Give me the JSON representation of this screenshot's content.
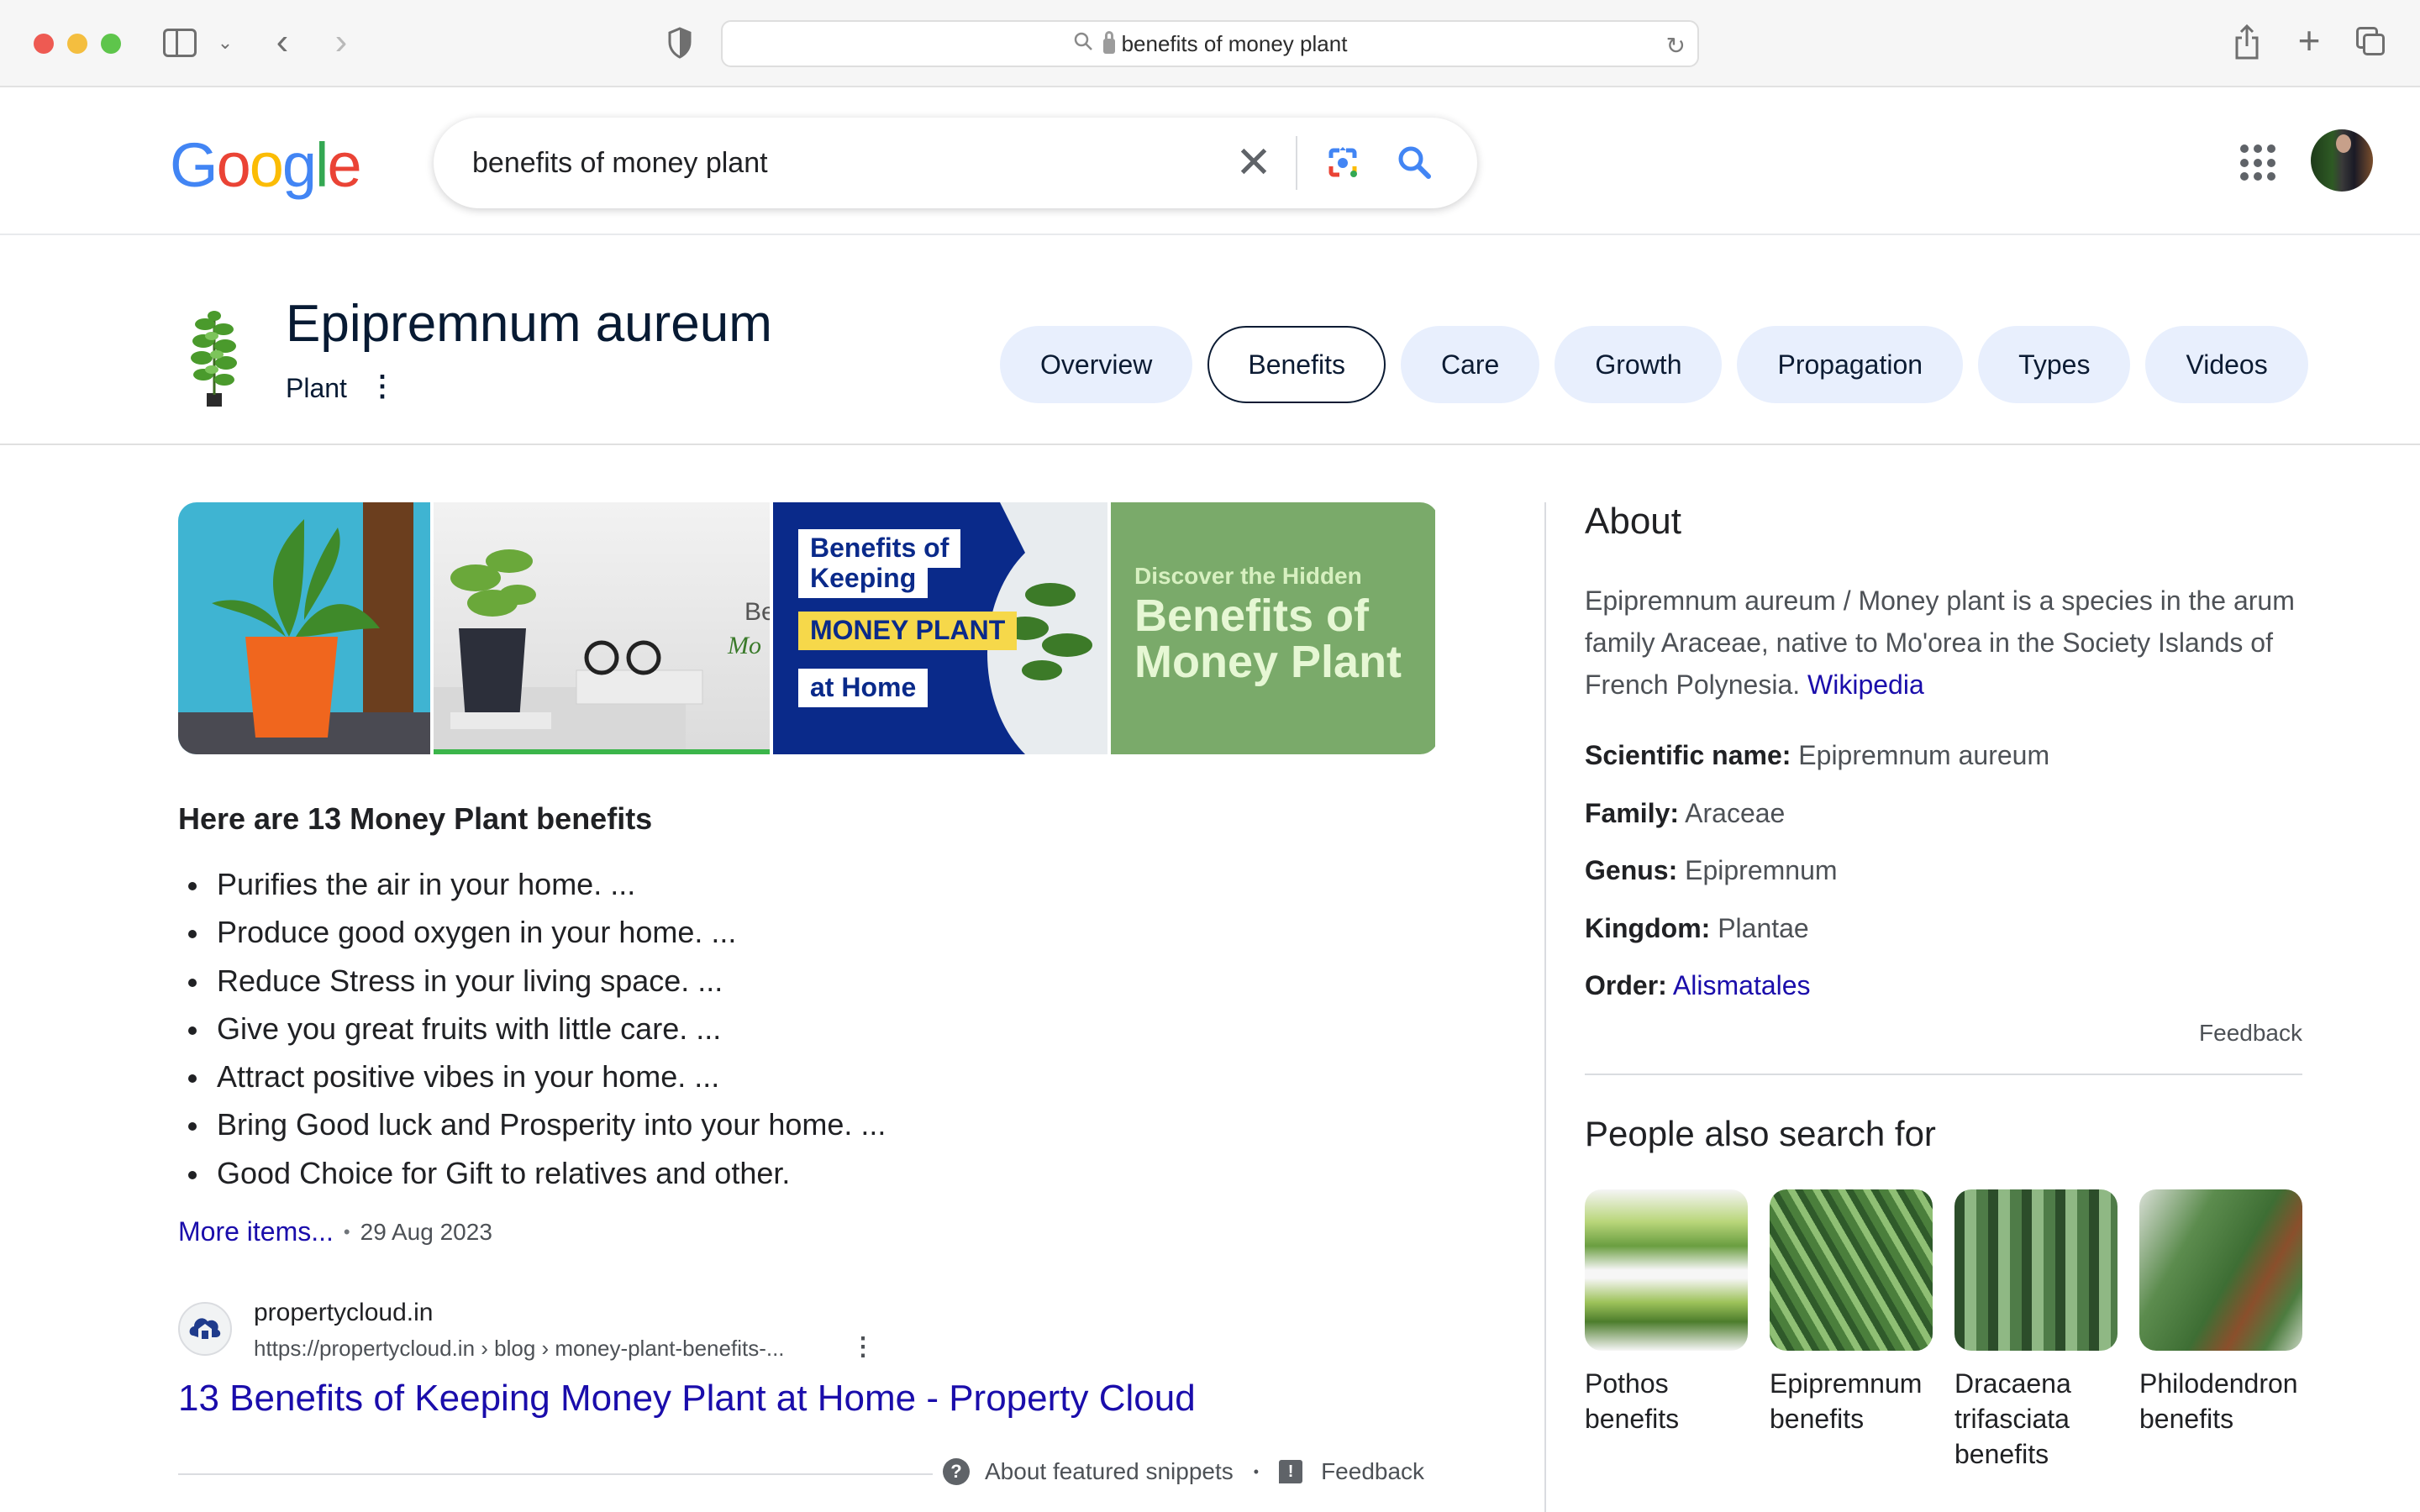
{
  "browser": {
    "url_text": "benefits of money plant",
    "icons": {
      "sidebar": "sidebar-icon",
      "sidebar_chevron": "chevron-down-icon",
      "back": "chevron-left-icon",
      "forward": "chevron-right-icon",
      "privacy": "shield-icon",
      "search": "magnifier-icon",
      "lock": "lock-icon",
      "reload": "reload-icon",
      "share": "share-icon",
      "new_tab": "plus-icon",
      "tabs": "tab-overview-icon"
    }
  },
  "google": {
    "logo_letters": [
      "G",
      "o",
      "o",
      "g",
      "l",
      "e"
    ],
    "search_query": "benefits of money plant",
    "icons": {
      "clear": "close-icon",
      "lens": "google-lens-icon",
      "search": "search-icon",
      "apps": "apps-grid-icon",
      "avatar": "user-avatar"
    }
  },
  "entity": {
    "title": "Epipremnum aureum",
    "subtitle": "Plant",
    "chips": [
      {
        "label": "Overview",
        "active": false
      },
      {
        "label": "Benefits",
        "active": true
      },
      {
        "label": "Care",
        "active": false
      },
      {
        "label": "Growth",
        "active": false
      },
      {
        "label": "Propagation",
        "active": false
      },
      {
        "label": "Types",
        "active": false
      },
      {
        "label": "Videos",
        "active": false
      }
    ]
  },
  "images": [
    {
      "alt": "Money plant in orange pot"
    },
    {
      "alt": "Money plant on table with glasses",
      "overlay_text": "Be Mo"
    },
    {
      "alt": "Benefits of Keeping Money Plant at Home",
      "lines": [
        "Benefits of",
        "Keeping",
        "MONEY PLANT",
        "at Home"
      ]
    },
    {
      "alt": "Discover the Hidden Benefits of Money Plant",
      "small": "Discover the Hidden",
      "large": "Benefits of Money Plant"
    }
  ],
  "snippet": {
    "heading": "Here are 13 Money Plant benefits",
    "items": [
      "Purifies the air in your home. ...",
      "Produce good oxygen in your home. ...",
      "Reduce Stress in your living space. ...",
      "Give you great fruits with little care. ...",
      "Attract positive vibes in your home. ...",
      "Bring Good luck and Prosperity into your home. ...",
      "Good Choice for Gift to relatives and other."
    ],
    "more_items": "More items...",
    "date": "29 Aug 2023",
    "source": {
      "site_name": "propertycloud.in",
      "url": "https://propertycloud.in › blog › money-plant-benefits-...",
      "title": "13 Benefits of Keeping Money Plant at Home - Property Cloud"
    },
    "footer": {
      "about": "About featured snippets",
      "feedback": "Feedback"
    }
  },
  "knowledge_panel": {
    "about_title": "About",
    "description": "Epipremnum aureum / Money plant is a species in the arum family Araceae, native to Mo'orea in the Society Islands of French Polynesia.",
    "wiki_link": "Wikipedia",
    "facts": [
      {
        "label": "Scientific name:",
        "value": "Epipremnum aureum",
        "link": false
      },
      {
        "label": "Family:",
        "value": "Araceae",
        "link": false
      },
      {
        "label": "Genus:",
        "value": "Epipremnum",
        "link": false
      },
      {
        "label": "Kingdom:",
        "value": "Plantae",
        "link": false
      },
      {
        "label": "Order:",
        "value": "Alismatales",
        "link": true
      }
    ],
    "feedback": "Feedback",
    "people_also_search_title": "People also search for",
    "people_also_search": [
      {
        "label": "Pothos benefits"
      },
      {
        "label": "Epipremnum benefits"
      },
      {
        "label": "Dracaena trifasciata benefits"
      },
      {
        "label": "Philodendron benefits"
      }
    ]
  },
  "colors": {
    "link": "#1a0dab",
    "chip_bg": "#e8effd",
    "chip_text": "#0b1b33",
    "google_blue": "#4285f4",
    "google_red": "#ea4335",
    "google_yellow": "#fbbc05",
    "google_green": "#34a853"
  }
}
